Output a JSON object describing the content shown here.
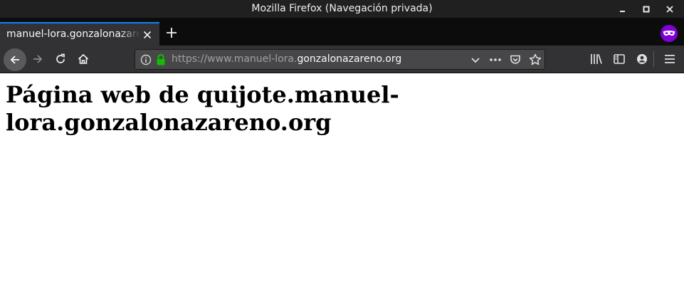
{
  "window": {
    "title": "Mozilla Firefox (Navegación privada)"
  },
  "tabs": [
    {
      "label": "manuel-lora.gonzalonazareno.org",
      "active": true
    }
  ],
  "navbar": {
    "url_prefix": "https://www.manuel-lora.",
    "url_host": "gonzalonazareno.org"
  },
  "page": {
    "heading": "Página web de quijote.manuel-lora.gonzalonazareno.org"
  },
  "colors": {
    "tab_accent": "#0a84ff",
    "private_badge": "#8000d7",
    "lock_green": "#12bc00"
  },
  "icons": [
    "minimize-icon",
    "maximize-icon",
    "close-icon",
    "tab-close-icon",
    "plus-icon",
    "private-browsing-icon",
    "back-arrow-icon",
    "forward-arrow-icon",
    "reload-icon",
    "home-icon",
    "info-icon",
    "lock-icon",
    "chevron-down-icon",
    "more-dots-icon",
    "pocket-icon",
    "star-icon",
    "library-icon",
    "sidebar-icon",
    "account-icon",
    "hamburger-menu-icon"
  ]
}
